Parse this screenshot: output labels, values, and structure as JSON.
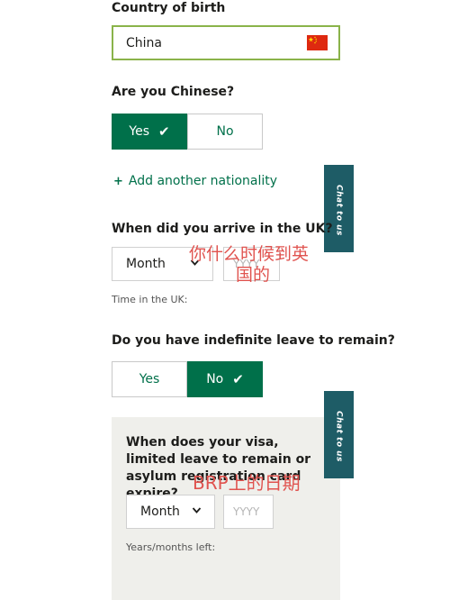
{
  "country_of_birth": {
    "label": "Country of birth",
    "value": "China",
    "flag_icon": "china-flag-icon"
  },
  "chinese_question": {
    "label": "Are you Chinese?",
    "yes_label": "Yes",
    "no_label": "No",
    "selected": "Yes"
  },
  "add_nationality": {
    "plus": "+",
    "label": "Add another nationality"
  },
  "chat_tab": {
    "label": "Chat to us"
  },
  "arrival": {
    "label": "When did you arrive in the UK?",
    "month_label": "Month",
    "year_placeholder": "YYYY",
    "note": "Time in the UK:"
  },
  "annotation_arrival": {
    "line1": "你什么时候到英",
    "line2": "国的"
  },
  "indefinite_leave": {
    "label": "Do you have indefinite leave to remain?",
    "yes_label": "Yes",
    "no_label": "No",
    "selected": "No"
  },
  "visa_expiry": {
    "question": "When does your visa, limited leave to remain or asylum registration card expire?",
    "month_label": "Month",
    "year_placeholder": "YYYY",
    "note": "Years/months left:"
  },
  "annotation_brp": {
    "text": "BRP上的日期"
  },
  "colors": {
    "brand_green": "#00704a",
    "input_border_active": "#8ab34a",
    "chat_tab": "#1e5c66",
    "annotation": "#e0534f",
    "panel_bg": "#efefeb"
  }
}
